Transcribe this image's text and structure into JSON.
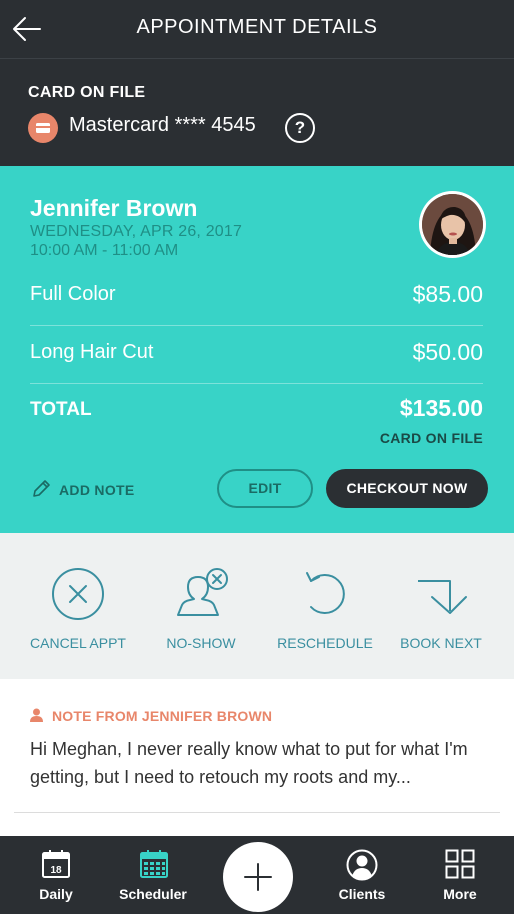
{
  "header": {
    "title": "APPOINTMENT DETAILS"
  },
  "card_on_file": {
    "label": "CARD ON FILE",
    "card_text": "Mastercard **** 4545",
    "help": "?"
  },
  "appointment": {
    "client_name": "Jennifer Brown",
    "date": "WEDNESDAY, APR 26, 2017",
    "time": "10:00 AM - 11:00 AM",
    "services": [
      {
        "name": "Full Color",
        "price": "$85.00"
      },
      {
        "name": "Long Hair Cut",
        "price": "$50.00"
      }
    ],
    "total_label": "TOTAL",
    "total_value": "$135.00",
    "payment_method": "CARD ON FILE",
    "add_note_label": "ADD NOTE",
    "edit_label": "EDIT",
    "checkout_label": "CHECKOUT NOW"
  },
  "actions": [
    {
      "label": "CANCEL APPT",
      "icon": "cancel-circle-icon"
    },
    {
      "label": "NO-SHOW",
      "icon": "no-show-person-icon"
    },
    {
      "label": "RESCHEDULE",
      "icon": "reschedule-arrow-icon"
    },
    {
      "label": "BOOK NEXT",
      "icon": "book-next-arrow-icon"
    }
  ],
  "note": {
    "title": "NOTE FROM JENNIFER BROWN",
    "body": "Hi Meghan, I never really know what to put for what I'm getting, but I need to retouch my roots and my..."
  },
  "bottom_nav": {
    "daily_label": "Daily",
    "daily_day": "18",
    "scheduler_label": "Scheduler",
    "clients_label": "Clients",
    "more_label": "More"
  },
  "colors": {
    "header_bg": "#2b2f33",
    "teal": "#38d3c7",
    "accent_orange": "#e8866a",
    "action_blue": "#3a8fa0",
    "scheduler_active": "#38d3c7"
  }
}
